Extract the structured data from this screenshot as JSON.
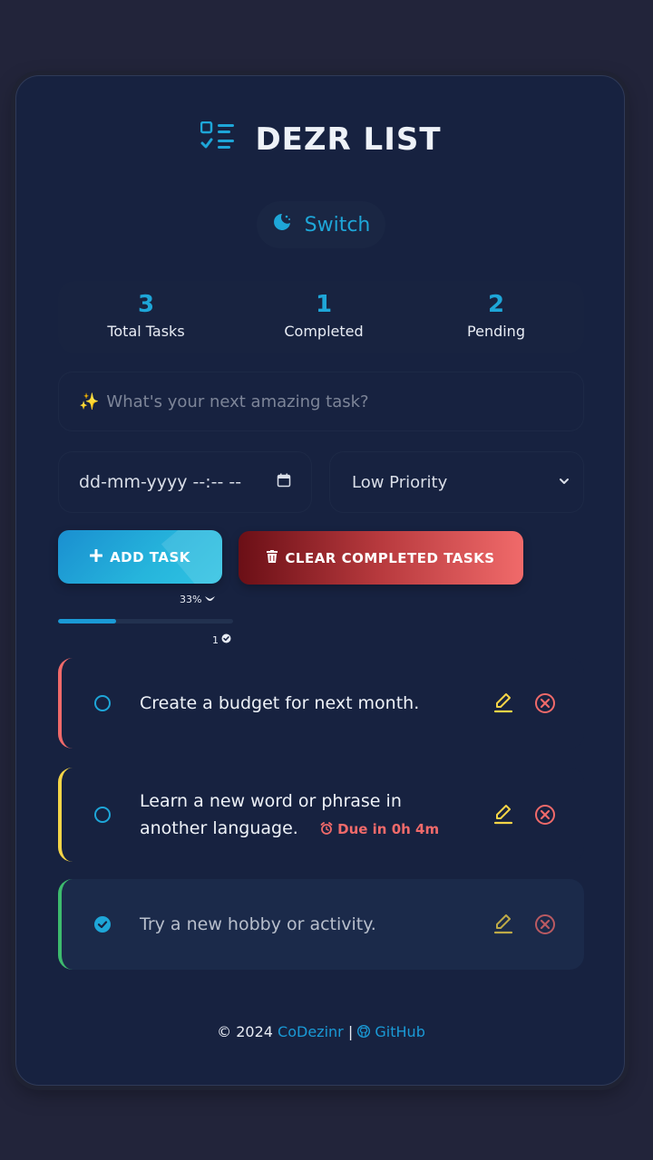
{
  "app": {
    "title": "DEZR LIST"
  },
  "theme_toggle": {
    "label": "Switch"
  },
  "stats": [
    {
      "value": "3",
      "label": "Total Tasks"
    },
    {
      "value": "1",
      "label": "Completed"
    },
    {
      "value": "2",
      "label": "Pending"
    }
  ],
  "new_task": {
    "emoji": "✨",
    "placeholder": "What's your next amazing task?"
  },
  "due_date": {
    "placeholder": "dd-mm-yyyy --:-- --"
  },
  "priority": {
    "selected": "Low Priority"
  },
  "actions": {
    "add_label": "ADD TASK",
    "clear_label": "CLEAR COMPLETED TASKS"
  },
  "progress": {
    "percent_text": "33%",
    "fraction": 0.33,
    "completed_count": "1"
  },
  "tasks": [
    {
      "text": "Create a budget for next month.",
      "completed": false,
      "priority_color": "#f06a6a",
      "due": ""
    },
    {
      "text": "Learn a new word or phrase in another language.",
      "completed": false,
      "priority_color": "#f5d547",
      "due": "Due in 0h 4m"
    },
    {
      "text": "Try a new hobby or activity.",
      "completed": true,
      "priority_color": "#3dbb6e",
      "due": ""
    }
  ],
  "footer": {
    "copyright": "© 2024",
    "author": "CoDezinr",
    "separator": "|",
    "github": "GitHub"
  },
  "colors": {
    "accent": "#1ea6d8",
    "danger": "#f06a6a",
    "edit": "#f5d547",
    "background": "#22243a",
    "card": "#172240"
  }
}
